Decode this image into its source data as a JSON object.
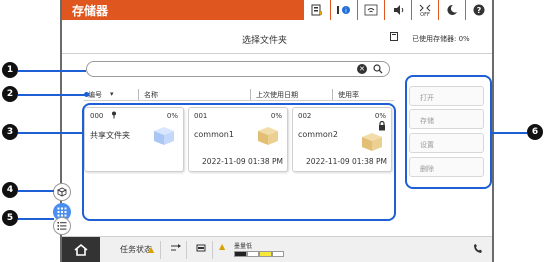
{
  "topbar": {
    "title": "存储器",
    "icons": [
      {
        "name": "network-status-icon",
        "glyph": "▤"
      },
      {
        "name": "info-icon",
        "glyph": "i⚙"
      },
      {
        "name": "wifi-icon",
        "glyph": "⌇"
      },
      {
        "name": "sound-icon",
        "glyph": "◀)"
      },
      {
        "name": "wifi-direct-off-icon",
        "glyph": "OFF"
      },
      {
        "name": "sleep-icon",
        "glyph": "☾"
      },
      {
        "name": "help-icon",
        "glyph": "?"
      }
    ]
  },
  "header": {
    "title": "选择文件夹",
    "storage_used": "已使用存储器: 0%"
  },
  "search": {
    "value": "",
    "placeholder": ""
  },
  "columns": {
    "number": "编号",
    "name": "名称",
    "last_used": "上次使用日期",
    "usage": "使用率"
  },
  "folders": [
    {
      "number": "000",
      "usage": "0%",
      "name": "共享文件夹",
      "date": "",
      "pinned": true,
      "locked": false
    },
    {
      "number": "001",
      "usage": "0%",
      "name": "common1",
      "date": "2022-11-09 01:38 PM",
      "pinned": false,
      "locked": false
    },
    {
      "number": "002",
      "usage": "0%",
      "name": "common2",
      "date": "2022-11-09 01:38 PM",
      "pinned": false,
      "locked": true
    }
  ],
  "actions": {
    "open": "打开",
    "store": "存储",
    "settings": "设置",
    "delete": "删除"
  },
  "side_tools": {
    "add_folder_icon": "folder-add-icon",
    "grid_view_icon": "grid-view-icon",
    "list_view_icon": "list-view-icon"
  },
  "bottombar": {
    "job_status": "任务状态",
    "ink_label": "墨量低"
  },
  "callouts": [
    "1",
    "2",
    "3",
    "4",
    "5",
    "6"
  ],
  "colors": {
    "accent": "#e0561f",
    "highlight": "#1f5fd6"
  }
}
